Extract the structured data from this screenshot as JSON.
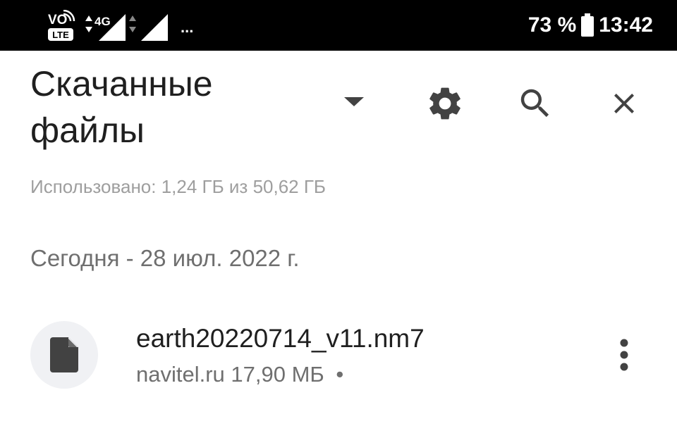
{
  "status_bar": {
    "volte_label": "VO",
    "lte_label": "LTE",
    "network_type": "4G",
    "more_label": "...",
    "battery_percent": "73 %",
    "time": "13:42"
  },
  "app_bar": {
    "title_line1": "Скачанные",
    "title_line2": "файлы",
    "icons": [
      "dropdown-arrow-icon",
      "gear-icon",
      "search-icon",
      "close-icon"
    ]
  },
  "storage_info": "Использовано: 1,24 ГБ из 50,62 ГБ",
  "section": {
    "header": "Сегодня - 28 июл. 2022 г.",
    "files": [
      {
        "name": "earth20220714_v11.nm7",
        "source": "navitel.ru",
        "size": "17,90 МБ",
        "separator": "•",
        "icon": "document-icon"
      }
    ]
  },
  "colors": {
    "status_bar_bg": "#000000",
    "background": "#ffffff",
    "primary_text": "#1f1f1f",
    "secondary_text": "#6f6f6f",
    "muted_text": "#9e9e9e",
    "icon": "#424242",
    "avatar_bg": "#f0f1f4"
  }
}
